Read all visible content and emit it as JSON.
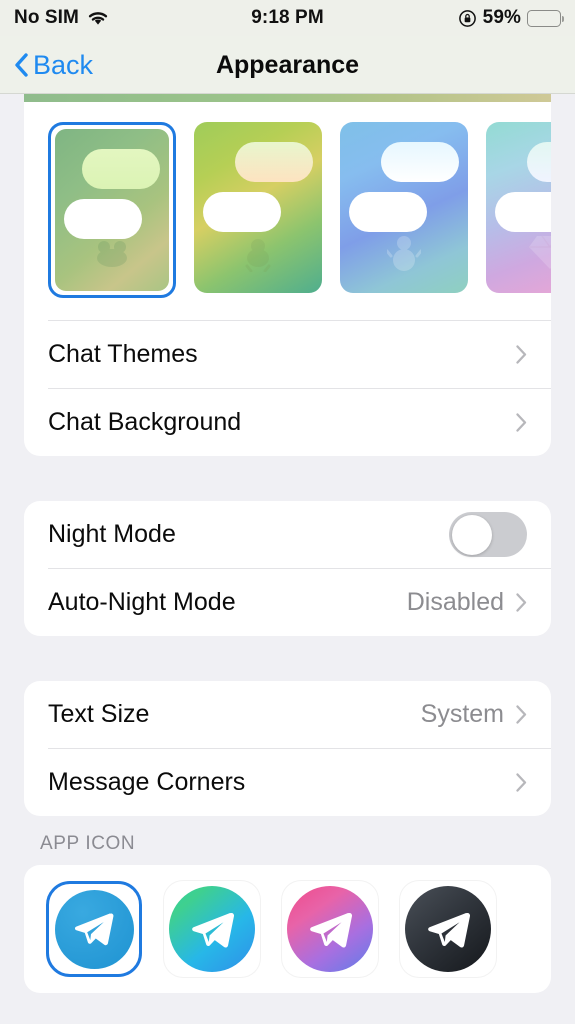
{
  "status_bar": {
    "carrier": "No SIM",
    "wifi_icon": "wifi-icon",
    "time": "9:18 PM",
    "rotation_lock_icon": "rotation-lock-icon",
    "battery_percent": "59%",
    "battery_level": 59
  },
  "nav": {
    "back_label": "Back",
    "back_icon": "chevron-left-icon",
    "title": "Appearance",
    "accent_color": "#1f8af0"
  },
  "theme_picker": {
    "selected_index": 0,
    "themes": [
      {
        "name": "green-doodle-theme",
        "selected": true,
        "background": "linear-gradient(140deg,#7fb583 0%,#8fbe86 30%,#a8c37f 60%,#c8c58a 80%,#a9c584 100%)",
        "outgoing_bubble": "linear-gradient(180deg,#e3f6c0,#dbf3b4)",
        "watermark_icon": "frog-doodle-icon"
      },
      {
        "name": "green-yellow-theme",
        "selected": false,
        "background": "linear-gradient(150deg,#9fcc5a 0%,#b6cf55 25%,#d6cf63 45%,#8cc46e 70%,#4fae8e 100%)",
        "outgoing_bubble": "linear-gradient(180deg,#e8f6cd,#fde3c0)",
        "watermark_icon": "duck-icon"
      },
      {
        "name": "blue-sky-theme",
        "selected": false,
        "background": "linear-gradient(155deg,#7fc0e8 0%,#86bdef 25%,#7f9ee8 55%,#8fc6d6 80%,#8fd0c0 100%)",
        "outgoing_bubble": "linear-gradient(180deg,#e6f7ff,#ffffff)",
        "watermark_icon": "snowman-icon"
      },
      {
        "name": "teal-pink-theme",
        "selected": false,
        "background": "linear-gradient(160deg,#93dbd3 0%,#a8d6e6 25%,#b6bde8 50%,#cfa8e0 72%,#efa6d2 100%)",
        "outgoing_bubble": "linear-gradient(180deg,#e2f7f2,#f0f4ff)",
        "watermark_icon": "gem-icon"
      }
    ]
  },
  "sections": {
    "chat": {
      "rows": [
        {
          "label": "Chat Themes",
          "value": "",
          "accessory": "chevron-right-icon",
          "name": "chat-themes"
        },
        {
          "label": "Chat Background",
          "value": "",
          "accessory": "chevron-right-icon",
          "name": "chat-background"
        }
      ]
    },
    "night": {
      "rows": [
        {
          "label": "Night Mode",
          "value": "",
          "accessory": "toggle",
          "toggle_on": false,
          "name": "night-mode"
        },
        {
          "label": "Auto-Night Mode",
          "value": "Disabled",
          "accessory": "chevron-right-icon",
          "name": "auto-night-mode"
        }
      ]
    },
    "text": {
      "rows": [
        {
          "label": "Text Size",
          "value": "System",
          "accessory": "chevron-right-icon",
          "name": "text-size"
        },
        {
          "label": "Message Corners",
          "value": "",
          "accessory": "chevron-right-icon",
          "name": "message-corners"
        }
      ]
    },
    "app_icon": {
      "header": "APP ICON",
      "selected_index": 0,
      "icons": [
        {
          "name": "telegram-blue-icon",
          "selected": true,
          "fill": "radial-gradient(circle at 35% 28%, #39a9e0 0%, #1f93d2 100%)"
        },
        {
          "name": "telegram-turquoise-icon",
          "selected": false,
          "fill": "linear-gradient(140deg,#2fd0a0 0%,#3fd08f 20%,#27b7e8 60%,#2f8fe8 100%)"
        },
        {
          "name": "telegram-pink-icon",
          "selected": false,
          "fill": "linear-gradient(145deg,#ef4b8a 0%,#e863a8 30%,#a86fe0 65%,#5f7de8 100%)"
        },
        {
          "name": "telegram-black-icon",
          "selected": false,
          "fill": "linear-gradient(140deg,#4a5058 0%,#30353c 45%,#15181c 100%)"
        }
      ]
    }
  },
  "colors": {
    "page_background": "#f0f0f4",
    "card_background": "#ffffff",
    "separator": "#e3e3e6",
    "secondary_text": "#8c8c90",
    "selection_blue": "#1f7ae0"
  }
}
